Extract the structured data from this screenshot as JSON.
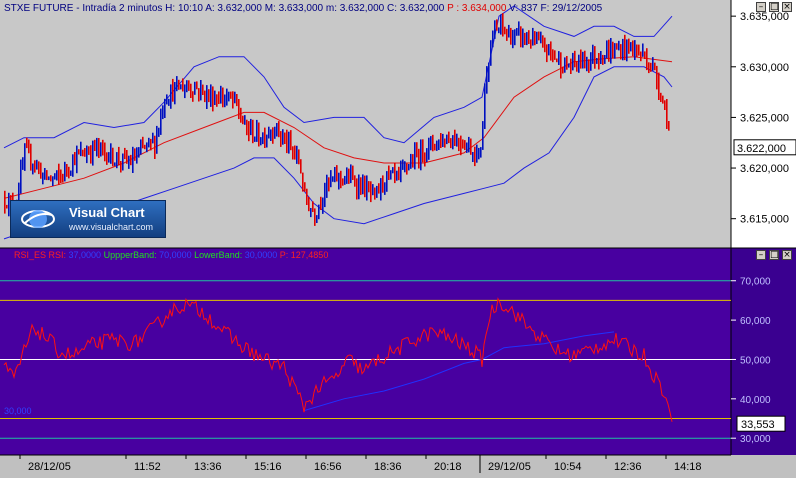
{
  "header": {
    "symbol": "STXE FUTURE - Intradía 2 minutos",
    "fields": [
      {
        "label": "H:",
        "value": "10:10",
        "color": "#000080"
      },
      {
        "label": "A:",
        "value": "3.632,000",
        "color": "#000080"
      },
      {
        "label": "M:",
        "value": "3.633,000",
        "color": "#000080"
      },
      {
        "label": "m:",
        "value": "3.632,000",
        "color": "#000080"
      },
      {
        "label": "C:",
        "value": "3.632,000",
        "color": "#000080"
      },
      {
        "label": "P :",
        "value": "3.634,000",
        "color": "#e00000"
      },
      {
        "label": "V:",
        "value": "837",
        "color": "#000080"
      },
      {
        "label": "F:",
        "value": "29/12/2005",
        "color": "#000080"
      }
    ]
  },
  "logo": {
    "name": "Visual Chart",
    "url": "www.visualchart.com"
  },
  "rsi_header": [
    {
      "text": "RSI_ES",
      "color": "#ff2020"
    },
    {
      "text": "RSI:",
      "color": "#ff2020"
    },
    {
      "text": "37,0000",
      "color": "#3040ff"
    },
    {
      "text": "UppperBand:",
      "color": "#20e020"
    },
    {
      "text": "70,0000",
      "color": "#3040ff"
    },
    {
      "text": "LowerBand:",
      "color": "#20e020"
    },
    {
      "text": "30,0000",
      "color": "#3040ff"
    },
    {
      "text": "P:",
      "color": "#ff2020"
    },
    {
      "text": "127,4850",
      "color": "#ff2020"
    }
  ],
  "rsi_side_label": "30,000",
  "price_axis": {
    "ticks": [
      "3.635,000",
      "3.630,000",
      "3.625,000",
      "3.620,000",
      "3.615,000"
    ],
    "tick_values": [
      3635,
      3630,
      3625,
      3620,
      3615
    ],
    "last_label": "3.622,000",
    "last_value": 3622
  },
  "rsi_axis": {
    "ticks": [
      "70,000",
      "60,000",
      "50,000",
      "40,000",
      "30,000"
    ],
    "tick_values": [
      70,
      60,
      50,
      40,
      30
    ],
    "last_label": "33,553",
    "last_value": 33.553
  },
  "x_axis": {
    "labels": [
      "28/12/05",
      "11:52",
      "13:36",
      "15:16",
      "16:56",
      "18:36",
      "20:18",
      "29/12/05",
      "10:54",
      "12:36",
      "14:18"
    ],
    "positions": [
      20,
      126,
      186,
      246,
      306,
      366,
      426,
      480,
      546,
      606,
      666
    ]
  },
  "chart_data": [
    {
      "type": "bar",
      "title": "STXE FUTURE - Intradía 2 minutos",
      "ylim": [
        3612.5,
        3636.2
      ],
      "x_count": 333,
      "close_anchors": [
        [
          0,
          3617
        ],
        [
          10,
          3616
        ],
        [
          20,
          3621.5
        ],
        [
          30,
          3620.5
        ],
        [
          40,
          3619
        ],
        [
          55,
          3619
        ],
        [
          70,
          3621
        ],
        [
          90,
          3622
        ],
        [
          110,
          3621
        ],
        [
          125,
          3620.5
        ],
        [
          140,
          3622
        ],
        [
          150,
          3622.5
        ],
        [
          160,
          3627
        ],
        [
          175,
          3628
        ],
        [
          190,
          3628
        ],
        [
          205,
          3627
        ],
        [
          220,
          3627
        ],
        [
          230,
          3626.5
        ],
        [
          240,
          3624
        ],
        [
          255,
          3623
        ],
        [
          270,
          3624
        ],
        [
          285,
          3622
        ],
        [
          295,
          3620.5
        ],
        [
          300,
          3617
        ],
        [
          310,
          3615.5
        ],
        [
          320,
          3618
        ],
        [
          330,
          3619
        ],
        [
          345,
          3619
        ],
        [
          360,
          3618
        ],
        [
          370,
          3617
        ],
        [
          380,
          3619
        ],
        [
          395,
          3619
        ],
        [
          400,
          3620
        ],
        [
          415,
          3621.5
        ],
        [
          430,
          3622.5
        ],
        [
          445,
          3623
        ],
        [
          460,
          3622.5
        ],
        [
          475,
          3621
        ],
        [
          482,
          3630
        ],
        [
          488,
          3633
        ],
        [
          495,
          3634
        ],
        [
          505,
          3633
        ],
        [
          515,
          3633
        ],
        [
          530,
          3632.5
        ],
        [
          545,
          3631.5
        ],
        [
          560,
          3630
        ],
        [
          575,
          3630.5
        ],
        [
          590,
          3631
        ],
        [
          605,
          3631.5
        ],
        [
          625,
          3632
        ],
        [
          640,
          3631
        ],
        [
          650,
          3629.5
        ],
        [
          660,
          3626
        ],
        [
          668,
          3622
        ]
      ],
      "bollinger": {
        "upper": [
          [
            0,
            3622
          ],
          [
            20,
            3623
          ],
          [
            50,
            3623
          ],
          [
            80,
            3624.5
          ],
          [
            110,
            3624
          ],
          [
            140,
            3624.5
          ],
          [
            160,
            3626.5
          ],
          [
            190,
            3630
          ],
          [
            215,
            3631
          ],
          [
            240,
            3631
          ],
          [
            260,
            3629
          ],
          [
            280,
            3626
          ],
          [
            300,
            3624.5
          ],
          [
            330,
            3625
          ],
          [
            360,
            3625
          ],
          [
            380,
            3623
          ],
          [
            400,
            3622.5
          ],
          [
            430,
            3625
          ],
          [
            460,
            3626
          ],
          [
            478,
            3627
          ],
          [
            495,
            3635
          ],
          [
            510,
            3636
          ],
          [
            540,
            3634
          ],
          [
            570,
            3633
          ],
          [
            590,
            3634
          ],
          [
            610,
            3634
          ],
          [
            630,
            3633
          ],
          [
            650,
            3633
          ],
          [
            668,
            3635
          ]
        ],
        "middle": [
          [
            0,
            3617
          ],
          [
            40,
            3618
          ],
          [
            80,
            3619
          ],
          [
            120,
            3620.5
          ],
          [
            160,
            3622.5
          ],
          [
            200,
            3624
          ],
          [
            240,
            3625.5
          ],
          [
            260,
            3625.5
          ],
          [
            290,
            3624
          ],
          [
            320,
            3622
          ],
          [
            350,
            3621
          ],
          [
            380,
            3620.5
          ],
          [
            420,
            3620.5
          ],
          [
            460,
            3621.5
          ],
          [
            480,
            3623
          ],
          [
            510,
            3627
          ],
          [
            540,
            3629
          ],
          [
            570,
            3630.5
          ],
          [
            600,
            3630.8
          ],
          [
            630,
            3631
          ],
          [
            668,
            3630.5
          ]
        ],
        "lower": [
          [
            0,
            3613
          ],
          [
            30,
            3614
          ],
          [
            60,
            3615
          ],
          [
            90,
            3615
          ],
          [
            110,
            3616
          ],
          [
            140,
            3617
          ],
          [
            170,
            3618
          ],
          [
            200,
            3619
          ],
          [
            230,
            3620
          ],
          [
            250,
            3621
          ],
          [
            270,
            3621
          ],
          [
            290,
            3619
          ],
          [
            310,
            3616.5
          ],
          [
            330,
            3615
          ],
          [
            360,
            3614.5
          ],
          [
            390,
            3615.5
          ],
          [
            420,
            3616.5
          ],
          [
            460,
            3617.5
          ],
          [
            480,
            3618
          ],
          [
            500,
            3618.5
          ],
          [
            520,
            3620
          ],
          [
            545,
            3621.5
          ],
          [
            570,
            3625
          ],
          [
            590,
            3629
          ],
          [
            610,
            3630
          ],
          [
            640,
            3630
          ],
          [
            660,
            3629
          ],
          [
            668,
            3628
          ]
        ]
      }
    },
    {
      "type": "line",
      "title": "RSI_ES",
      "ylim": [
        27,
        74
      ],
      "bands": {
        "upper": 70,
        "lower": 30,
        "overbought": 65,
        "oversold": 35,
        "mid": 50
      },
      "anchors": [
        [
          0,
          48
        ],
        [
          10,
          45
        ],
        [
          20,
          52
        ],
        [
          30,
          58
        ],
        [
          45,
          55
        ],
        [
          55,
          52
        ],
        [
          70,
          51
        ],
        [
          90,
          54
        ],
        [
          110,
          55
        ],
        [
          130,
          54
        ],
        [
          150,
          58
        ],
        [
          165,
          62
        ],
        [
          180,
          64
        ],
        [
          200,
          62
        ],
        [
          220,
          57
        ],
        [
          240,
          53
        ],
        [
          260,
          50
        ],
        [
          280,
          48
        ],
        [
          300,
          38
        ],
        [
          315,
          43
        ],
        [
          330,
          45
        ],
        [
          345,
          50
        ],
        [
          360,
          47
        ],
        [
          375,
          50
        ],
        [
          390,
          52
        ],
        [
          410,
          55
        ],
        [
          430,
          57
        ],
        [
          450,
          55
        ],
        [
          470,
          52
        ],
        [
          478,
          50
        ],
        [
          485,
          61
        ],
        [
          495,
          65
        ],
        [
          510,
          62
        ],
        [
          525,
          58
        ],
        [
          540,
          55
        ],
        [
          555,
          52
        ],
        [
          570,
          51
        ],
        [
          590,
          53
        ],
        [
          610,
          55
        ],
        [
          625,
          53
        ],
        [
          640,
          51
        ],
        [
          650,
          46
        ],
        [
          660,
          42
        ],
        [
          668,
          33.5
        ]
      ],
      "signal_line": [
        [
          300,
          37
        ],
        [
          340,
          40
        ],
        [
          380,
          42
        ],
        [
          420,
          45
        ],
        [
          460,
          49
        ],
        [
          478,
          50
        ],
        [
          500,
          53
        ],
        [
          540,
          54
        ],
        [
          580,
          56
        ],
        [
          610,
          57
        ]
      ]
    }
  ]
}
